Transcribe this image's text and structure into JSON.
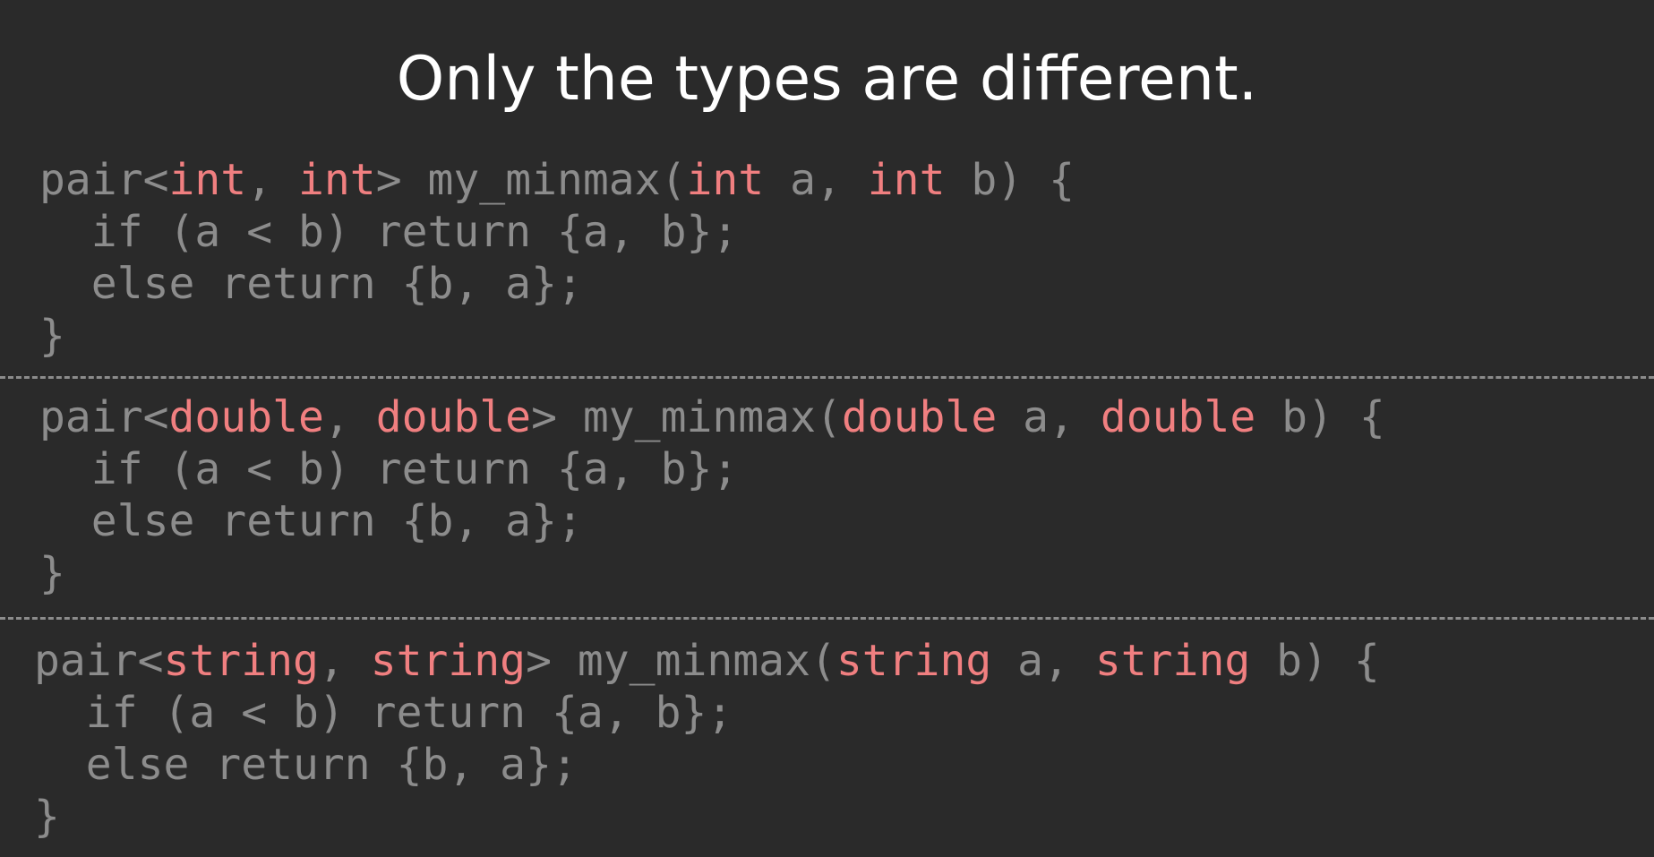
{
  "title": "Only the types are different.",
  "colors": {
    "background": "#2a2a2a",
    "title": "#ffffff",
    "code": "#8c8c8c",
    "type_highlight": "#f07f80"
  },
  "blocks": [
    {
      "type": "int",
      "line1_prefix": "pair<",
      "line1_sep1": ", ",
      "line1_mid": "> my_minmax(",
      "line1_sep2": " a, ",
      "line1_end": " b) {",
      "line2": "  if (a < b) return {a, b};",
      "line3": "  else return {b, a};",
      "line4": "}"
    },
    {
      "type": "double",
      "line1_prefix": "pair<",
      "line1_sep1": ", ",
      "line1_mid": "> my_minmax(",
      "line1_sep2": " a, ",
      "line1_end": " b) {",
      "line2": "  if (a < b) return {a, b};",
      "line3": "  else return {b, a};",
      "line4": "}"
    },
    {
      "type": "string",
      "line1_prefix": "pair<",
      "line1_sep1": ", ",
      "line1_mid": "> my_minmax(",
      "line1_sep2": " a, ",
      "line1_end": " b) {",
      "line2": "  if (a < b) return {a, b};",
      "line3": "  else return {b, a};",
      "line4": "}"
    }
  ]
}
